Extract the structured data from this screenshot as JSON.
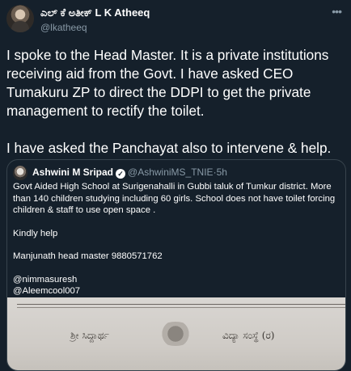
{
  "author": {
    "display_name": "ಎಲ್ ಕೆ ಅತೀಕ್ L K Atheeq",
    "handle": "@lkatheeq"
  },
  "more_icon": "more-horizontal-icon",
  "tweet": {
    "paragraphs": [
      "I spoke to the Head Master. It is a private institutions receiving aid from the Govt. I have asked CEO Tumakuru ZP to direct the DDPI to get the private management to rectify the toilet.",
      "I have asked the Panchayat also to intervene & help."
    ]
  },
  "quoted": {
    "name": "Ashwini M Sripad",
    "verified_icon": "verified-badge-icon",
    "handle": "@AshwiniMS_TNIE",
    "separator": "·",
    "time": "5h",
    "text1": "Govt Aided High School at Surigenahalli in Gubbi taluk of Tumkur district. More than 140 children studying including 60 girls. School does not have toilet forcing children & staff to use open space .",
    "text2": "Kindly help",
    "text3": "Manjunath head master 9880571762",
    "mention1": "@nimmasuresh",
    "mention2": "@Aleemcool007",
    "image_text_left": "ಶ್ರೀ ಸಿದ್ದಾರ್ಥ",
    "image_text_right": "ವಿದ್ಯಾ ಸಂಸ್ಥೆ (ರ)"
  }
}
